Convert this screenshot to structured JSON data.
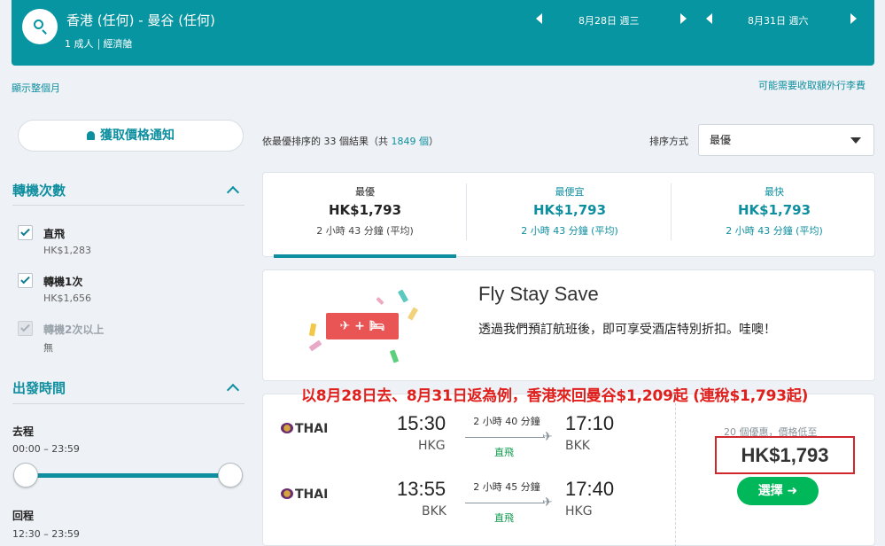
{
  "header": {
    "route": "香港 (任何) - 曼谷 (任何)",
    "passengers": "1 成人",
    "cabin": "經濟艙",
    "depart_date": "8月28日 週三",
    "return_date": "8月31日 週六"
  },
  "links": {
    "show_month": "顯示整個月",
    "baggage_fees": "可能需要收取額外行李費"
  },
  "sidebar": {
    "price_alert_label": "獲取價格通知",
    "stops": {
      "title": "轉機次數",
      "options": [
        {
          "label": "直飛",
          "price": "HK$1,283",
          "checked": true,
          "disabled": false
        },
        {
          "label": "轉機1次",
          "price": "HK$1,656",
          "checked": true,
          "disabled": false
        },
        {
          "label": "轉機2次以上",
          "price": "無",
          "checked": true,
          "disabled": true
        }
      ]
    },
    "departure_times": {
      "title": "出發時間",
      "outbound_label": "去程",
      "outbound_range": "00:00 – 23:59",
      "return_label": "回程",
      "return_range": "12:30 – 23:59"
    }
  },
  "results": {
    "summary_prefix": "依最優排序的 33 個結果（共",
    "total": "1849 個",
    "summary_suffix": "）",
    "sort_label": "排序方式",
    "sort_value": "最優"
  },
  "tabs": [
    {
      "name": "最優",
      "price": "HK$1,793",
      "duration": "2 小時 43 分鐘 (平均)",
      "active": true
    },
    {
      "name": "最便宜",
      "price": "HK$1,793",
      "duration": "2 小時 43 分鐘 (平均)",
      "active": false
    },
    {
      "name": "最快",
      "price": "HK$1,793",
      "duration": "2 小時 43 分鐘 (平均)",
      "active": false
    }
  ],
  "promo": {
    "title": "Fly Stay Save",
    "text": "透過我們預訂航班後，即可享受酒店特別折扣。哇噢！",
    "card_label": "✈ + 🛏",
    "colors": {
      "card": "#e95454"
    }
  },
  "annotation": "以8月28日去、8月31日返為例，香港來回曼谷$1,209起 (連稅$1,793起)",
  "flight": {
    "outbound": {
      "airline": "THAI",
      "depart_time": "15:30",
      "depart_code": "HKG",
      "duration": "2 小時 40 分鐘",
      "stops": "直飛",
      "arrive_time": "17:10",
      "arrive_code": "BKK"
    },
    "inbound": {
      "airline": "THAI",
      "depart_time": "13:55",
      "depart_code": "BKK",
      "duration": "2 小時 45 分鐘",
      "stops": "直飛",
      "arrive_time": "17:40",
      "arrive_code": "HKG"
    },
    "offers_text": "20 個優惠，價格低至",
    "price": "HK$1,793",
    "select_label": "選擇 ➜"
  }
}
